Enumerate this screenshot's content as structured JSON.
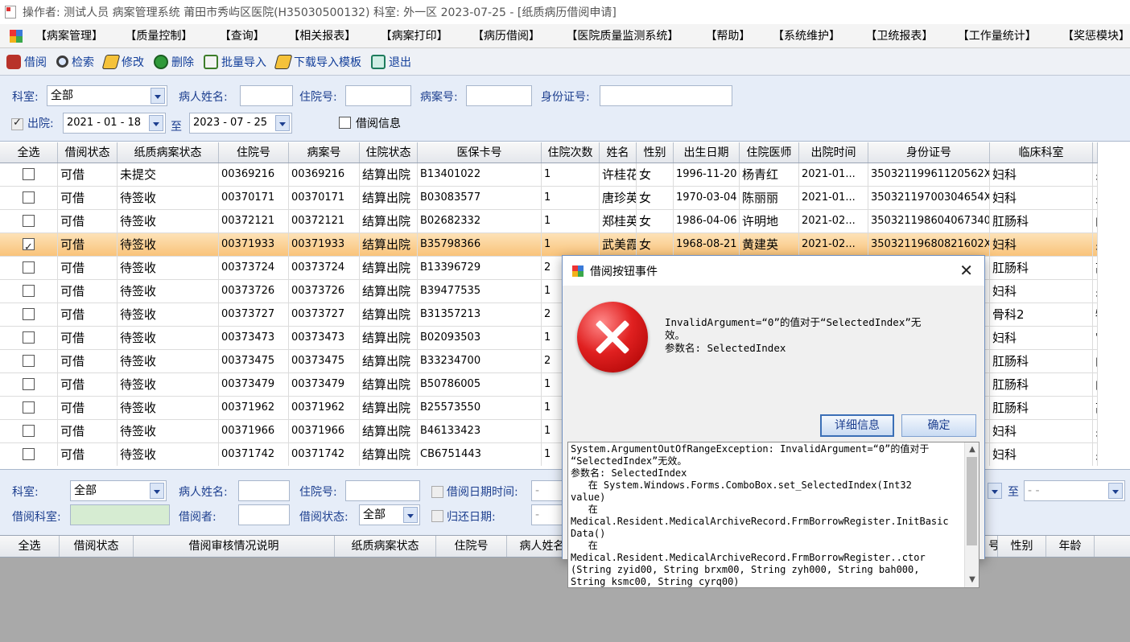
{
  "title_bar": {
    "text": "操作者: 测试人员 病案管理系统  莆田市秀屿区医院(H35030500132)  科室: 外一区 2023-07-25  - [纸质病历借阅申请]"
  },
  "menu": {
    "items": [
      "【病案管理】",
      "【质量控制】",
      "【查询】",
      "【相关报表】",
      "【病案打印】",
      "【病历借阅】",
      "【医院质量监测系统】",
      "【帮助】",
      "【系统维护】",
      "【卫统报表】",
      "【工作量统计】",
      "【奖惩模块】"
    ]
  },
  "toolbar": {
    "items": [
      {
        "label": "借阅",
        "icon": "borrow-icon"
      },
      {
        "label": "检索",
        "icon": "search-icon"
      },
      {
        "label": "修改",
        "icon": "edit-icon"
      },
      {
        "label": "删除",
        "icon": "delete-icon"
      },
      {
        "label": "批量导入",
        "icon": "import-icon"
      },
      {
        "label": "下载导入模板",
        "icon": "download-icon"
      },
      {
        "label": "退出",
        "icon": "exit-icon"
      }
    ]
  },
  "filter": {
    "dept_label": "科室:",
    "dept_value": "全部",
    "name_label": "病人姓名:",
    "name_value": "",
    "admission_label": "住院号:",
    "admission_value": "",
    "record_label": "病案号:",
    "record_value": "",
    "idcard_label": "身份证号:",
    "idcard_value": "",
    "discharge_label": "出院:",
    "discharge_from": "2021 - 01 - 18",
    "to_label": "至",
    "discharge_to": "2023 - 07 - 25",
    "borrow_info_label": "借阅信息"
  },
  "grid": {
    "columns": [
      "全选",
      "借阅状态",
      "纸质病案状态",
      "住院号",
      "病案号",
      "住院状态",
      "医保卡号",
      "住院次数",
      "姓名",
      "性别",
      "出生日期",
      "住院医师",
      "出院时间",
      "身份证号",
      "临床科室",
      ""
    ],
    "rows": [
      {
        "checked": false,
        "borrow": "可借",
        "paper": "未提交",
        "adm": "00369216",
        "rec": "00369216",
        "status": "结算出院",
        "card": "B13401022",
        "times": "1",
        "name": "许桂花",
        "sex": "女",
        "birth": "1996-11-20",
        "doctor": "杨青红",
        "out": "2021-01...",
        "id": "35032119961120562X",
        "dept": "妇科",
        "extra": "另"
      },
      {
        "checked": false,
        "borrow": "可借",
        "paper": "待签收",
        "adm": "00370171",
        "rec": "00370171",
        "status": "结算出院",
        "card": "B03083577",
        "times": "1",
        "name": "唐珍英",
        "sex": "女",
        "birth": "1970-03-04",
        "doctor": "陈丽丽",
        "out": "2021-01...",
        "id": "35032119700304654X",
        "dept": "妇科",
        "extra": "另"
      },
      {
        "checked": false,
        "borrow": "可借",
        "paper": "待签收",
        "adm": "00372121",
        "rec": "00372121",
        "status": "结算出院",
        "card": "B02682332",
        "times": "1",
        "name": "郑桂英",
        "sex": "女",
        "birth": "1986-04-06",
        "doctor": "许明地",
        "out": "2021-02...",
        "id": "350321198604067340",
        "dept": "肛肠科",
        "extra": "门"
      },
      {
        "checked": true,
        "borrow": "可借",
        "paper": "待签收",
        "adm": "00371933",
        "rec": "00371933",
        "status": "结算出院",
        "card": "B35798366",
        "times": "1",
        "name": "武美霞",
        "sex": "女",
        "birth": "1968-08-21",
        "doctor": "黄建英",
        "out": "2021-02...",
        "id": "35032119680821602X",
        "dept": "妇科",
        "extra": "另"
      },
      {
        "checked": false,
        "borrow": "可借",
        "paper": "待签收",
        "adm": "00373724",
        "rec": "00373724",
        "status": "结算出院",
        "card": "B13396729",
        "times": "2",
        "name": "",
        "sex": "",
        "birth": "",
        "doctor": "",
        "out": "",
        "id": "05737",
        "dept": "肛肠科",
        "extra": "高"
      },
      {
        "checked": false,
        "borrow": "可借",
        "paper": "待签收",
        "adm": "00373726",
        "rec": "00373726",
        "status": "结算出院",
        "card": "B39477535",
        "times": "1",
        "name": "",
        "sex": "",
        "birth": "",
        "doctor": "",
        "out": "",
        "id": "30083",
        "dept": "妇科",
        "extra": "另"
      },
      {
        "checked": false,
        "borrow": "可借",
        "paper": "待签收",
        "adm": "00373727",
        "rec": "00373727",
        "status": "结算出院",
        "card": "B31357213",
        "times": "2",
        "name": "",
        "sex": "",
        "birth": "",
        "doctor": "",
        "out": "",
        "id": "50140",
        "dept": "骨科2",
        "extra": "牡"
      },
      {
        "checked": false,
        "borrow": "可借",
        "paper": "待签收",
        "adm": "00373473",
        "rec": "00373473",
        "status": "结算出院",
        "card": "B02093503",
        "times": "1",
        "name": "",
        "sex": "",
        "birth": "",
        "doctor": "",
        "out": "",
        "id": "48129",
        "dept": "妇科",
        "extra": "宫"
      },
      {
        "checked": false,
        "borrow": "可借",
        "paper": "待签收",
        "adm": "00373475",
        "rec": "00373475",
        "status": "结算出院",
        "card": "B33234700",
        "times": "2",
        "name": "",
        "sex": "",
        "birth": "",
        "doctor": "",
        "out": "",
        "id": "1033X",
        "dept": "肛肠科",
        "extra": "门"
      },
      {
        "checked": false,
        "borrow": "可借",
        "paper": "待签收",
        "adm": "00373479",
        "rec": "00373479",
        "status": "结算出院",
        "card": "B50786005",
        "times": "1",
        "name": "",
        "sex": "",
        "birth": "",
        "doctor": "",
        "out": "",
        "id": "1141X",
        "dept": "肛肠科",
        "extra": "门"
      },
      {
        "checked": false,
        "borrow": "可借",
        "paper": "待签收",
        "adm": "00371962",
        "rec": "00371962",
        "status": "结算出院",
        "card": "B25573550",
        "times": "1",
        "name": "",
        "sex": "",
        "birth": "",
        "doctor": "",
        "out": "",
        "id": "9071X",
        "dept": "肛肠科",
        "extra": "高"
      },
      {
        "checked": false,
        "borrow": "可借",
        "paper": "待签收",
        "adm": "00371966",
        "rec": "00371966",
        "status": "结算出院",
        "card": "B46133423",
        "times": "1",
        "name": "",
        "sex": "",
        "birth": "",
        "doctor": "",
        "out": "",
        "id": "7564X",
        "dept": "妇科",
        "extra": "另"
      },
      {
        "checked": false,
        "borrow": "可借",
        "paper": "待签收",
        "adm": "00371742",
        "rec": "00371742",
        "status": "结算出院",
        "card": "CB6751443",
        "times": "1",
        "name": "",
        "sex": "",
        "birth": "",
        "doctor": "",
        "out": "",
        "id": "50380",
        "dept": "妇科",
        "extra": "另"
      }
    ]
  },
  "bottom_filter": {
    "dept_label": "科室:",
    "dept_value": "全部",
    "name_label": "病人姓名:",
    "name_value": "",
    "admission_label": "住院号:",
    "admission_value": "",
    "borrow_date_label": "借阅日期时间:",
    "borrow_date_from": "-",
    "to_label": "至",
    "borrow_date_to": "-   -",
    "borrow_dept_label": "借阅科室:",
    "borrow_dept_value": "",
    "borrower_label": "借阅者:",
    "borrower_value": "",
    "borrow_status_label": "借阅状态:",
    "borrow_status_value": "全部",
    "return_date_label": "归还日期:",
    "return_date_value": "-"
  },
  "bottom_grid": {
    "columns": [
      "全选",
      "借阅状态",
      "借阅审核情况说明",
      "纸质病案状态",
      "住院号",
      "病人姓名",
      "号",
      "性别",
      "年龄"
    ]
  },
  "dialog": {
    "title": "借阅按钮事件",
    "message": "InvalidArgument=“0”的值对于“SelectedIndex”无\n效。\n参数名: SelectedIndex",
    "detail_button": "详细信息",
    "ok_button": "确定",
    "detail_text": "System.ArgumentOutOfRangeException: InvalidArgument=“0”的值对于\n“SelectedIndex”无效。\n参数名: SelectedIndex\n   在 System.Windows.Forms.ComboBox.set_SelectedIndex(Int32\nvalue)\n   在\nMedical.Resident.MedicalArchiveRecord.FrmBorrowRegister.InitBasic\nData()\n   在\nMedical.Resident.MedicalArchiveRecord.FrmBorrowRegister..ctor\n(String zyid00, String brxm00, String zyh000, String bah000,\nString ksmc00, String cyrq00)"
  },
  "colors": {
    "selected_row": "#f9c37a",
    "panel_bg": "#e6edf8",
    "label_blue": "#1d3f8f",
    "error_red": "#e02020"
  }
}
